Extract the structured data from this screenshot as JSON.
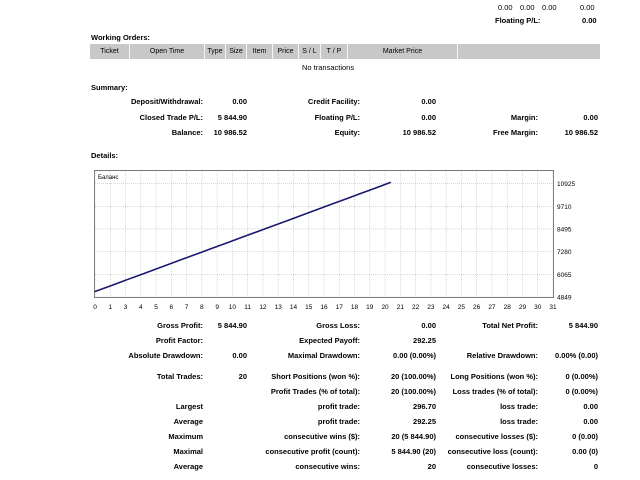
{
  "top_row": {
    "v1": "0.00",
    "v2": "0.00",
    "v3": "0.00",
    "v4": "0.00"
  },
  "floating_top": {
    "label": "Floating P/L:",
    "value": "0.00"
  },
  "working_orders": {
    "title": "Working Orders:",
    "columns": [
      "Ticket",
      "Open Time",
      "Type",
      "Size",
      "Item",
      "Price",
      "S / L",
      "T / P",
      "Market Price"
    ],
    "empty_text": "No transactions"
  },
  "summary": {
    "title": "Summary:",
    "deposit_label": "Deposit/Withdrawal:",
    "deposit_value": "0.00",
    "credit_label": "Credit Facility:",
    "credit_value": "0.00",
    "closed_label": "Closed Trade P/L:",
    "closed_value": "5 844.90",
    "floating_label": "Floating P/L:",
    "floating_value": "0.00",
    "margin_label": "Margin:",
    "margin_value": "0.00",
    "balance_label": "Balance:",
    "balance_value": "10 986.52",
    "equity_label": "Equity:",
    "equity_value": "10 986.52",
    "free_margin_label": "Free Margin:",
    "free_margin_value": "10 986.52"
  },
  "details": {
    "title": "Details:",
    "gross_profit_label": "Gross Profit:",
    "gross_profit_value": "5 844.90",
    "gross_loss_label": "Gross Loss:",
    "gross_loss_value": "0.00",
    "net_profit_label": "Total Net Profit:",
    "net_profit_value": "5 844.90",
    "profit_factor_label": "Profit Factor:",
    "profit_factor_value": "",
    "expected_payoff_label": "Expected Payoff:",
    "expected_payoff_value": "292.25",
    "abs_dd_label": "Absolute Drawdown:",
    "abs_dd_value": "0.00",
    "max_dd_label": "Maximal Drawdown:",
    "max_dd_value": "0.00 (0.00%)",
    "rel_dd_label": "Relative Drawdown:",
    "rel_dd_value": "0.00% (0.00)",
    "total_trades_label": "Total Trades:",
    "total_trades_value": "20",
    "short_label": "Short Positions (won %):",
    "short_value": "20 (100.00%)",
    "long_label": "Long Positions (won %):",
    "long_value": "0 (0.00%)",
    "profit_trades_label": "Profit Trades (% of total):",
    "profit_trades_value": "20 (100.00%)",
    "loss_trades_label": "Loss trades (% of total):",
    "loss_trades_value": "0 (0.00%)",
    "largest_label": "Largest",
    "largest_profit_label": "profit trade:",
    "largest_profit_value": "296.70",
    "largest_loss_label": "loss trade:",
    "largest_loss_value": "0.00",
    "average_label": "Average",
    "average_profit_label": "profit trade:",
    "average_profit_value": "292.25",
    "average_loss_label": "loss trade:",
    "average_loss_value": "0.00",
    "maximum_label": "Maximum",
    "max_wins_label": "consecutive wins ($):",
    "max_wins_value": "20 (5 844.90)",
    "max_losses_label": "consecutive losses ($):",
    "max_losses_value": "0 (0.00)",
    "maximal_label": "Maximal",
    "maximal_profit_label": "consecutive profit (count):",
    "maximal_profit_value": "5 844.90 (20)",
    "maximal_loss_label": "consecutive loss (count):",
    "maximal_loss_value": "0.00 (0)",
    "average2_label": "Average",
    "avg_wins_label": "consecutive wins:",
    "avg_wins_value": "20",
    "avg_losses_label": "consecutive losses:",
    "avg_losses_value": "0"
  },
  "chart_data": {
    "type": "line",
    "title": "Баланс",
    "xlabel": "",
    "ylabel": "",
    "xlim": [
      0,
      31
    ],
    "ylim": [
      4849,
      11600
    ],
    "x_ticks": [
      "0",
      "1",
      "3",
      "4",
      "5",
      "6",
      "7",
      "8",
      "9",
      "10",
      "11",
      "12",
      "13",
      "14",
      "15",
      "16",
      "17",
      "18",
      "19",
      "20",
      "21",
      "22",
      "23",
      "24",
      "25",
      "26",
      "27",
      "28",
      "29",
      "30",
      "31"
    ],
    "y_ticks": [
      10925,
      9710,
      8495,
      7280,
      6065,
      4849
    ],
    "series": [
      {
        "name": "Баланс",
        "color": "#1a1a6e",
        "x": [
          0,
          1,
          2,
          3,
          4,
          5,
          6,
          7,
          8,
          9,
          10,
          11,
          12,
          13,
          14,
          15,
          16,
          17,
          18,
          19,
          20
        ],
        "y": [
          5142,
          5434,
          5726,
          6018,
          6310,
          6602,
          6894,
          7186,
          7478,
          7770,
          8062,
          8354,
          8646,
          8938,
          9230,
          9522,
          9814,
          10106,
          10398,
          10690,
          10987
        ]
      }
    ],
    "grid": true
  }
}
